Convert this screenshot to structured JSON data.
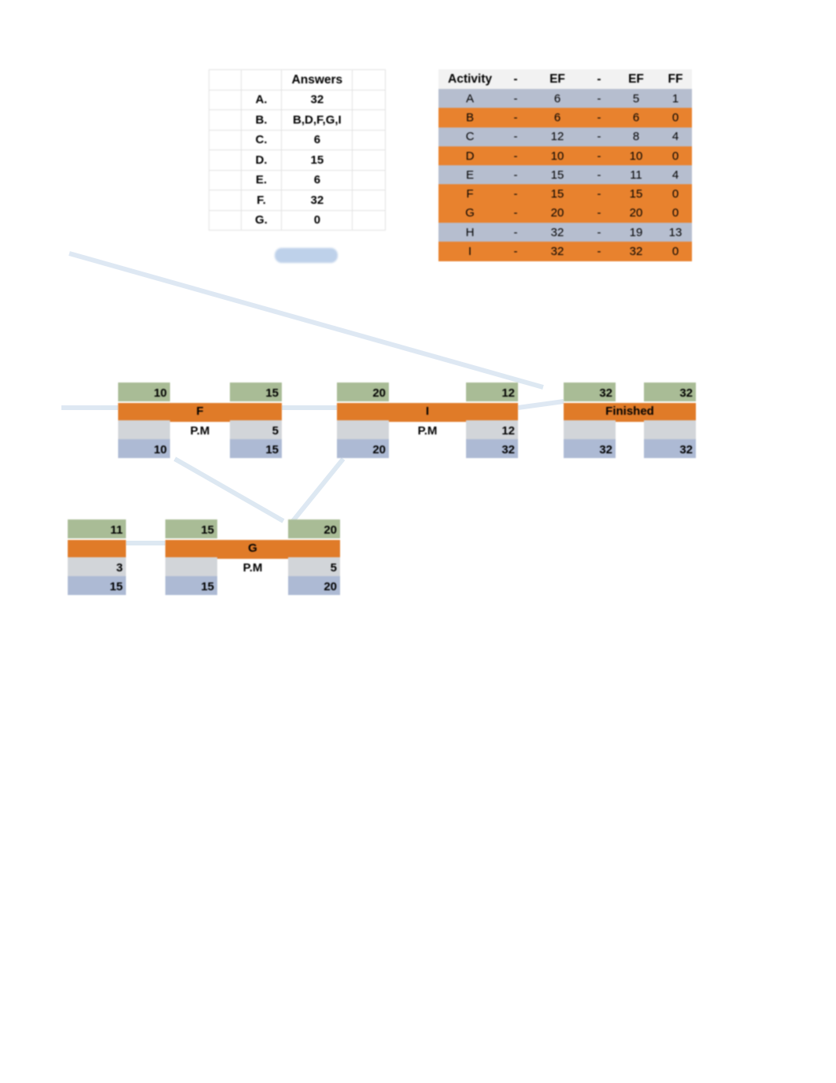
{
  "answers_table": {
    "header": "Answers",
    "rows": [
      {
        "label": "A.",
        "value": "32"
      },
      {
        "label": "B.",
        "value": "B,D,F,G,I"
      },
      {
        "label": "C.",
        "value": "6"
      },
      {
        "label": "D.",
        "value": "15"
      },
      {
        "label": "E.",
        "value": "6"
      },
      {
        "label": "F.",
        "value": "32"
      },
      {
        "label": "G.",
        "value": "0"
      }
    ]
  },
  "activity_table": {
    "columns": [
      "Activity",
      "-",
      "EF",
      "-",
      "EF",
      "FF"
    ],
    "rows": [
      {
        "activity": "A",
        "d1": "-",
        "ef1": "6",
        "d2": "-",
        "ef2": "5",
        "ff": "1",
        "style": "blue"
      },
      {
        "activity": "B",
        "d1": "-",
        "ef1": "6",
        "d2": "-",
        "ef2": "6",
        "ff": "0",
        "style": "orange"
      },
      {
        "activity": "C",
        "d1": "-",
        "ef1": "12",
        "d2": "-",
        "ef2": "8",
        "ff": "4",
        "style": "blue"
      },
      {
        "activity": "D",
        "d1": "-",
        "ef1": "10",
        "d2": "-",
        "ef2": "10",
        "ff": "0",
        "style": "orange"
      },
      {
        "activity": "E",
        "d1": "-",
        "ef1": "15",
        "d2": "-",
        "ef2": "11",
        "ff": "4",
        "style": "blue"
      },
      {
        "activity": "F",
        "d1": "-",
        "ef1": "15",
        "d2": "-",
        "ef2": "15",
        "ff": "0",
        "style": "orange"
      },
      {
        "activity": "G",
        "d1": "-",
        "ef1": "20",
        "d2": "-",
        "ef2": "20",
        "ff": "0",
        "style": "orange"
      },
      {
        "activity": "H",
        "d1": "-",
        "ef1": "32",
        "d2": "-",
        "ef2": "19",
        "ff": "13",
        "style": "blue"
      },
      {
        "activity": "I",
        "d1": "-",
        "ef1": "32",
        "d2": "-",
        "ef2": "32",
        "ff": "0",
        "style": "orange"
      }
    ]
  },
  "network": {
    "nodes": [
      {
        "id": "F",
        "label": "F",
        "sublabel": "P.M",
        "left_top": "10",
        "left_mid": "",
        "left_bottom": "10",
        "right_top": "15",
        "right_mid": "5",
        "right_bottom": "15"
      },
      {
        "id": "I",
        "label": "I",
        "sublabel": "P.M",
        "left_top": "20",
        "left_mid": "",
        "left_bottom": "20",
        "right_top": "12",
        "right_mid": "12",
        "right_bottom": "32"
      },
      {
        "id": "Finished",
        "label": "Finished",
        "sublabel": "",
        "left_top": "32",
        "left_mid": "",
        "left_bottom": "32",
        "right_top": "32",
        "right_mid": "",
        "right_bottom": "32"
      },
      {
        "id": "partial",
        "label": "",
        "sublabel": "",
        "left_top": "11",
        "left_mid": "3",
        "left_bottom": "15",
        "right_top": "",
        "right_mid": "",
        "right_bottom": ""
      },
      {
        "id": "G",
        "label": "G",
        "sublabel": "P.M",
        "left_top": "15",
        "left_mid": "",
        "left_bottom": "15",
        "right_top": "20",
        "right_mid": "5",
        "right_bottom": "20"
      }
    ]
  },
  "colors": {
    "band_green": "#a9bc96",
    "band_orange": "#e07b28",
    "band_gray": "#d2d5d9",
    "band_blue": "#adbad4",
    "table_row_blue": "#b6becf",
    "table_row_orange": "#e8822e",
    "connector": "#dce7f2",
    "pill_blue": "#bed1ea"
  }
}
